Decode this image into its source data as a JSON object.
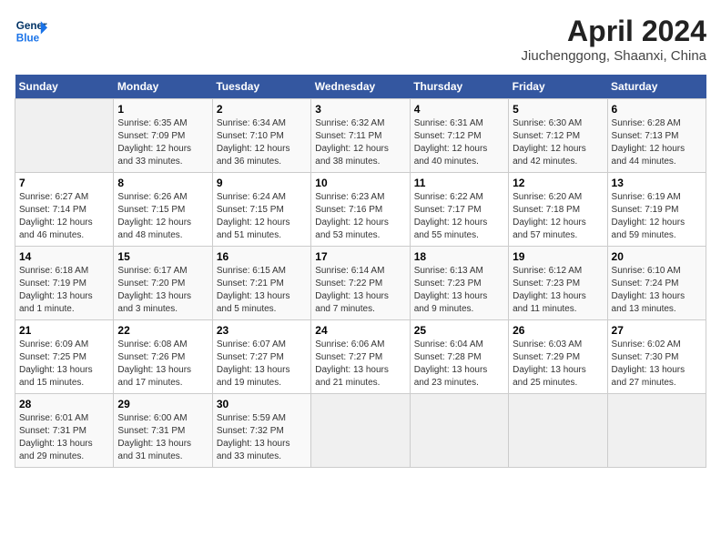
{
  "header": {
    "logo_line1": "General",
    "logo_line2": "Blue",
    "title": "April 2024",
    "subtitle": "Jiuchenggong, Shaanxi, China"
  },
  "columns": [
    "Sunday",
    "Monday",
    "Tuesday",
    "Wednesday",
    "Thursday",
    "Friday",
    "Saturday"
  ],
  "weeks": [
    [
      {
        "day": "",
        "info": ""
      },
      {
        "day": "1",
        "info": "Sunrise: 6:35 AM\nSunset: 7:09 PM\nDaylight: 12 hours\nand 33 minutes."
      },
      {
        "day": "2",
        "info": "Sunrise: 6:34 AM\nSunset: 7:10 PM\nDaylight: 12 hours\nand 36 minutes."
      },
      {
        "day": "3",
        "info": "Sunrise: 6:32 AM\nSunset: 7:11 PM\nDaylight: 12 hours\nand 38 minutes."
      },
      {
        "day": "4",
        "info": "Sunrise: 6:31 AM\nSunset: 7:12 PM\nDaylight: 12 hours\nand 40 minutes."
      },
      {
        "day": "5",
        "info": "Sunrise: 6:30 AM\nSunset: 7:12 PM\nDaylight: 12 hours\nand 42 minutes."
      },
      {
        "day": "6",
        "info": "Sunrise: 6:28 AM\nSunset: 7:13 PM\nDaylight: 12 hours\nand 44 minutes."
      }
    ],
    [
      {
        "day": "7",
        "info": "Sunrise: 6:27 AM\nSunset: 7:14 PM\nDaylight: 12 hours\nand 46 minutes."
      },
      {
        "day": "8",
        "info": "Sunrise: 6:26 AM\nSunset: 7:15 PM\nDaylight: 12 hours\nand 48 minutes."
      },
      {
        "day": "9",
        "info": "Sunrise: 6:24 AM\nSunset: 7:15 PM\nDaylight: 12 hours\nand 51 minutes."
      },
      {
        "day": "10",
        "info": "Sunrise: 6:23 AM\nSunset: 7:16 PM\nDaylight: 12 hours\nand 53 minutes."
      },
      {
        "day": "11",
        "info": "Sunrise: 6:22 AM\nSunset: 7:17 PM\nDaylight: 12 hours\nand 55 minutes."
      },
      {
        "day": "12",
        "info": "Sunrise: 6:20 AM\nSunset: 7:18 PM\nDaylight: 12 hours\nand 57 minutes."
      },
      {
        "day": "13",
        "info": "Sunrise: 6:19 AM\nSunset: 7:19 PM\nDaylight: 12 hours\nand 59 minutes."
      }
    ],
    [
      {
        "day": "14",
        "info": "Sunrise: 6:18 AM\nSunset: 7:19 PM\nDaylight: 13 hours\nand 1 minute."
      },
      {
        "day": "15",
        "info": "Sunrise: 6:17 AM\nSunset: 7:20 PM\nDaylight: 13 hours\nand 3 minutes."
      },
      {
        "day": "16",
        "info": "Sunrise: 6:15 AM\nSunset: 7:21 PM\nDaylight: 13 hours\nand 5 minutes."
      },
      {
        "day": "17",
        "info": "Sunrise: 6:14 AM\nSunset: 7:22 PM\nDaylight: 13 hours\nand 7 minutes."
      },
      {
        "day": "18",
        "info": "Sunrise: 6:13 AM\nSunset: 7:23 PM\nDaylight: 13 hours\nand 9 minutes."
      },
      {
        "day": "19",
        "info": "Sunrise: 6:12 AM\nSunset: 7:23 PM\nDaylight: 13 hours\nand 11 minutes."
      },
      {
        "day": "20",
        "info": "Sunrise: 6:10 AM\nSunset: 7:24 PM\nDaylight: 13 hours\nand 13 minutes."
      }
    ],
    [
      {
        "day": "21",
        "info": "Sunrise: 6:09 AM\nSunset: 7:25 PM\nDaylight: 13 hours\nand 15 minutes."
      },
      {
        "day": "22",
        "info": "Sunrise: 6:08 AM\nSunset: 7:26 PM\nDaylight: 13 hours\nand 17 minutes."
      },
      {
        "day": "23",
        "info": "Sunrise: 6:07 AM\nSunset: 7:27 PM\nDaylight: 13 hours\nand 19 minutes."
      },
      {
        "day": "24",
        "info": "Sunrise: 6:06 AM\nSunset: 7:27 PM\nDaylight: 13 hours\nand 21 minutes."
      },
      {
        "day": "25",
        "info": "Sunrise: 6:04 AM\nSunset: 7:28 PM\nDaylight: 13 hours\nand 23 minutes."
      },
      {
        "day": "26",
        "info": "Sunrise: 6:03 AM\nSunset: 7:29 PM\nDaylight: 13 hours\nand 25 minutes."
      },
      {
        "day": "27",
        "info": "Sunrise: 6:02 AM\nSunset: 7:30 PM\nDaylight: 13 hours\nand 27 minutes."
      }
    ],
    [
      {
        "day": "28",
        "info": "Sunrise: 6:01 AM\nSunset: 7:31 PM\nDaylight: 13 hours\nand 29 minutes."
      },
      {
        "day": "29",
        "info": "Sunrise: 6:00 AM\nSunset: 7:31 PM\nDaylight: 13 hours\nand 31 minutes."
      },
      {
        "day": "30",
        "info": "Sunrise: 5:59 AM\nSunset: 7:32 PM\nDaylight: 13 hours\nand 33 minutes."
      },
      {
        "day": "",
        "info": ""
      },
      {
        "day": "",
        "info": ""
      },
      {
        "day": "",
        "info": ""
      },
      {
        "day": "",
        "info": ""
      }
    ]
  ]
}
